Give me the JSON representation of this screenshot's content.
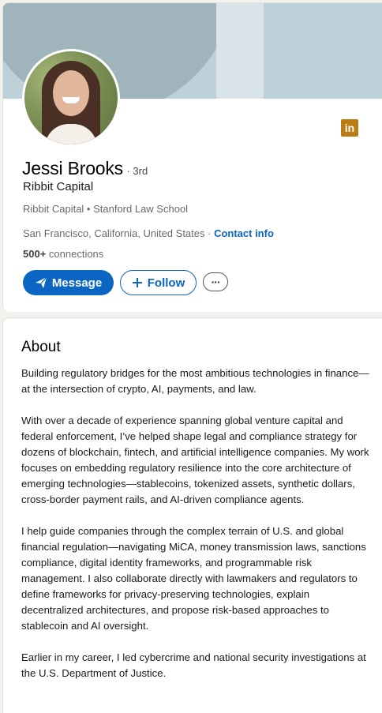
{
  "profile": {
    "name": "Jessi Brooks",
    "degree": "· 3rd",
    "headline": "Ribbit Capital",
    "companies": "Ribbit Capital • Stanford Law School",
    "location": "San Francisco, California, United States",
    "location_separator": " · ",
    "contact_info": "Contact info",
    "connections_count": "500+",
    "connections_label": " connections",
    "network_badge_icon": "linkedin-icon",
    "badge_text": "in"
  },
  "actions": {
    "message_label": "Message",
    "message_icon": "send-icon",
    "follow_label": "Follow",
    "follow_icon": "plus-icon",
    "more_label": "···"
  },
  "about": {
    "title": "About",
    "paragraphs": [
      "Building regulatory bridges for the most ambitious technologies in finance—at the intersection of crypto, AI, payments, and law.",
      "With over a decade of experience spanning global venture capital and federal enforcement, I’ve helped shape legal and compliance strategy for dozens of blockchain, fintech, and artificial intelligence companies. My work focuses on embedding regulatory resilience into the core architecture of emerging technologies—stablecoins, tokenized assets, synthetic dollars, cross-border payment rails, and AI-driven compliance agents.",
      "I help guide companies through the complex terrain of U.S. and global financial regulation—navigating MiCA, money transmission laws, sanctions compliance, digital identity frameworks, and programmable risk management. I also collaborate directly with lawmakers and regulators to define frameworks for privacy-preserving technologies, explain decentralized architectures, and propose risk-based approaches to stablecoin and AI oversight.",
      "Earlier in my career, I led cybercrime and national security investigations at the U.S. Department of Justice."
    ]
  },
  "colors": {
    "accent": "#0a66c2",
    "banner": "#bcd2d8",
    "badge": "#b97d14"
  }
}
